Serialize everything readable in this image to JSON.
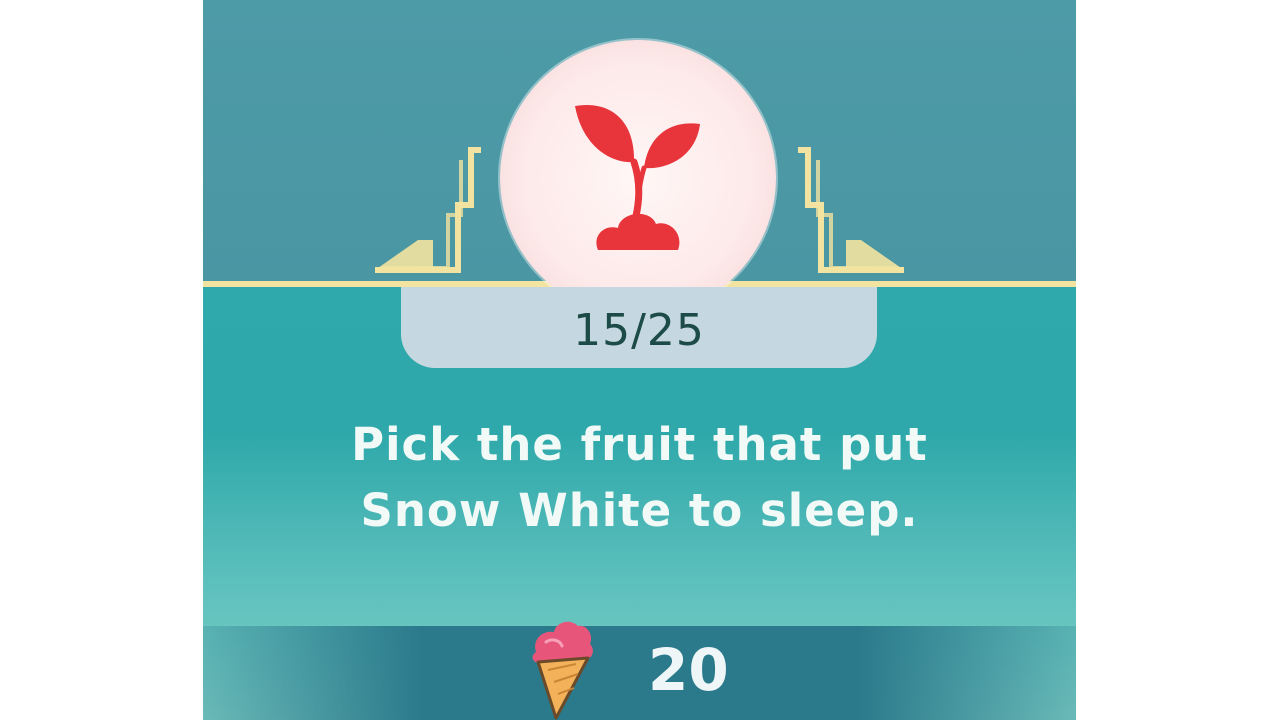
{
  "quiz": {
    "progress_text": "15/25",
    "progress": {
      "current": 15,
      "total": 25
    },
    "question_line1": "Pick the fruit that put",
    "question_line2": "Snow White to sleep.",
    "category_icon": "sprout-icon",
    "reward_icon": "ice-cream-cone-icon",
    "reward_value": "20"
  },
  "colors": {
    "panel_top": "#4b9aa6",
    "panel_bottom": "#7fd0c6",
    "gold_trim": "#f3e3a0",
    "emblem_icon": "#e8353c",
    "counter_bg": "#c5d8e1",
    "counter_text": "#1d4b47",
    "reward_bar": "#2b7a8c"
  }
}
